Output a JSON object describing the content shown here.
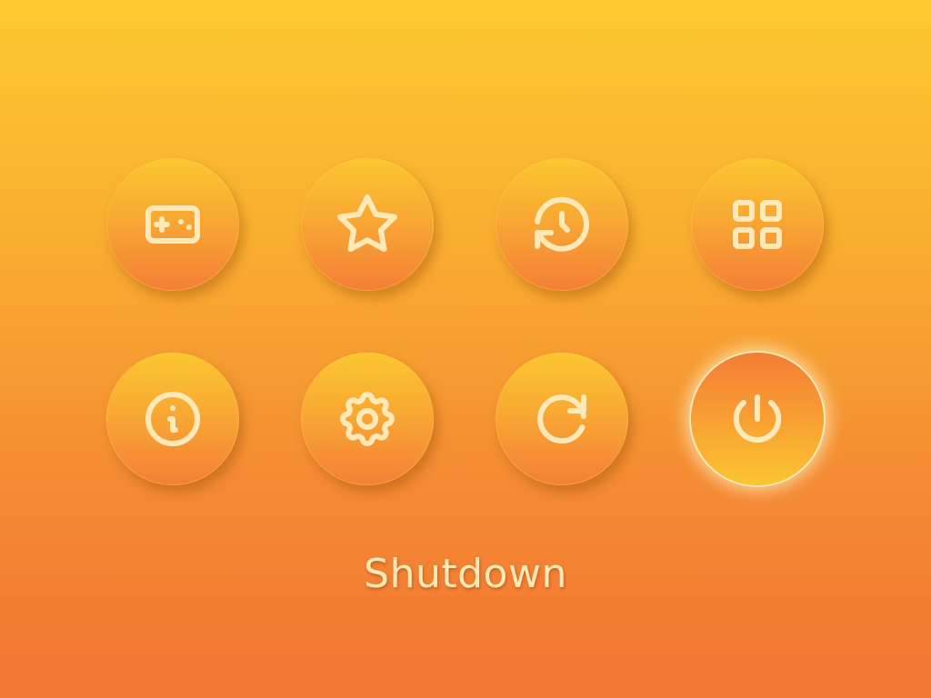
{
  "menu": {
    "buttons": [
      {
        "icon": "gamepad-icon"
      },
      {
        "icon": "star-icon"
      },
      {
        "icon": "history-icon"
      },
      {
        "icon": "apps-grid-icon"
      },
      {
        "icon": "info-icon"
      },
      {
        "icon": "settings-gear-icon"
      },
      {
        "icon": "restart-icon"
      },
      {
        "icon": "power-icon",
        "selected": true
      }
    ],
    "selected_label": "Shutdown"
  },
  "colors": {
    "background_top": "#fdca31",
    "background_bottom": "#f27533",
    "icon_stroke": "#ffe9b8",
    "selected_glow": "#ffecbe"
  }
}
